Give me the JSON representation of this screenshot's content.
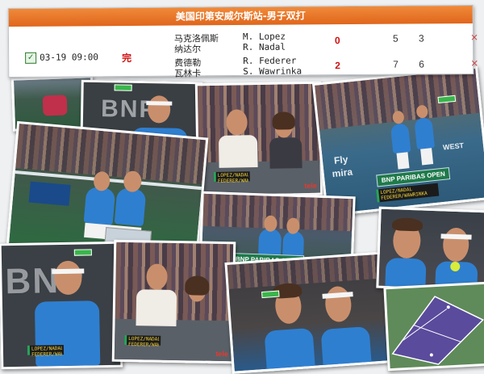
{
  "scoreboard": {
    "title": "美国印第安威尔斯站-男子双打",
    "datetime": "03-19 09:00",
    "status": "完",
    "team1": {
      "players_cn": [
        "马克洛佩斯",
        "纳达尔"
      ],
      "players_en": [
        "M. Lopez",
        "R. Nadal"
      ],
      "sets_won": "0",
      "set1": "5",
      "set2": "3"
    },
    "team2": {
      "players_cn": [
        "费德勒",
        "瓦林卡"
      ],
      "players_en": [
        "R. Federer",
        "S. Wawrinka"
      ],
      "sets_won": "2",
      "set1": "7",
      "set2": "6"
    },
    "close_symbol": "×"
  },
  "photos": {
    "bnp_text": "BNP",
    "tournament_banner": "BNP PARIBAS OPEN",
    "tele_logo": "tele",
    "fly_text": "Fly",
    "emirates_text": "mira",
    "west_text": "WEST",
    "score_bug_lines": [
      "LOPEZ/NADAL",
      "FEDERER/WAWRINKA"
    ]
  },
  "colors": {
    "scoreboard_header": "#e0661c",
    "score_red": "#d01010",
    "shirt_blue": "#2f7fd0",
    "court_purple": "#5a4b9c"
  }
}
